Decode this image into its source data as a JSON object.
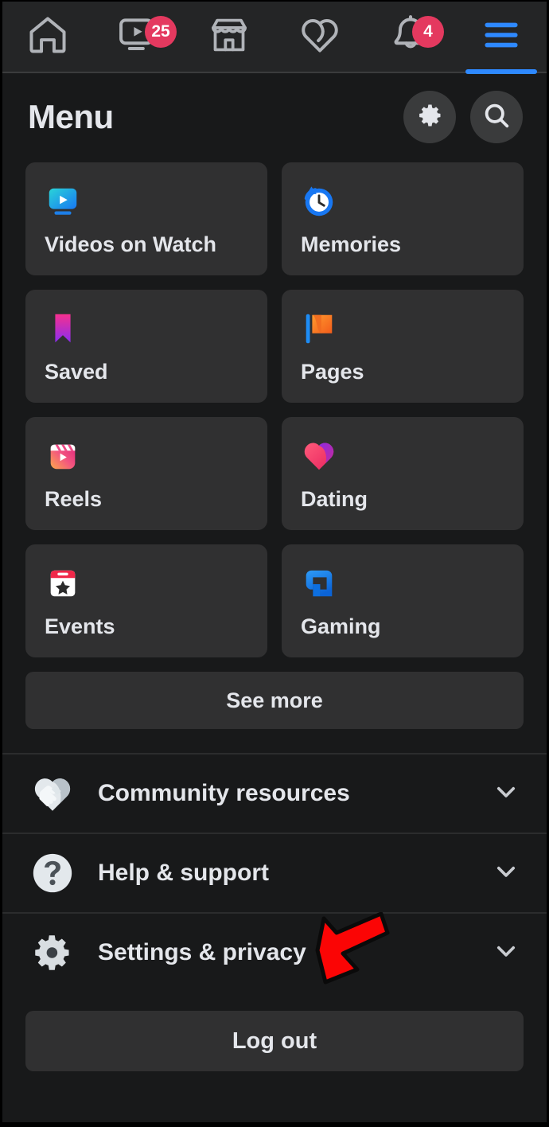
{
  "app": {
    "background_color": "#18191A",
    "tile_color": "#303031",
    "text_color": "#E4E6EB",
    "accent_color": "#2E89FF",
    "badge_color": "#E4395F"
  },
  "topnav": {
    "items": [
      {
        "icon": "home-icon",
        "label": "Home",
        "badge": null,
        "active": false
      },
      {
        "icon": "watch-video-icon",
        "label": "Video",
        "badge": "25",
        "active": false
      },
      {
        "icon": "marketplace-icon",
        "label": "Marketplace",
        "badge": null,
        "active": false
      },
      {
        "icon": "dating-heart-icon",
        "label": "Dating",
        "badge": null,
        "active": false
      },
      {
        "icon": "notifications-bell-icon",
        "label": "Notifications",
        "badge": "4",
        "active": false
      },
      {
        "icon": "hamburger-menu-icon",
        "label": "Menu",
        "badge": null,
        "active": true
      }
    ]
  },
  "header": {
    "title": "Menu",
    "settings_icon": "gear-icon",
    "search_icon": "search-icon"
  },
  "shortcuts": {
    "tiles": [
      {
        "label": "Videos on Watch",
        "icon": "watch-tile-icon"
      },
      {
        "label": "Memories",
        "icon": "memories-clock-icon"
      },
      {
        "label": "Saved",
        "icon": "saved-bookmark-icon"
      },
      {
        "label": "Pages",
        "icon": "pages-flag-icon"
      },
      {
        "label": "Reels",
        "icon": "reels-clapperboard-icon"
      },
      {
        "label": "Dating",
        "icon": "dating-heart-icon"
      },
      {
        "label": "Events",
        "icon": "events-calendar-icon"
      },
      {
        "label": "Gaming",
        "icon": "gaming-g-icon"
      }
    ],
    "see_more_label": "See more"
  },
  "sections": [
    {
      "label": "Community resources",
      "icon": "handshake-heart-icon",
      "chevron": "chevron-down-icon"
    },
    {
      "label": "Help & support",
      "icon": "question-mark-icon",
      "chevron": "chevron-down-icon"
    },
    {
      "label": "Settings & privacy",
      "icon": "settings-gear-icon",
      "chevron": "chevron-down-icon"
    }
  ],
  "footer": {
    "logout_label": "Log out"
  },
  "annotation": {
    "type": "arrow",
    "color": "#FF0000",
    "points_to": "Settings & privacy"
  }
}
